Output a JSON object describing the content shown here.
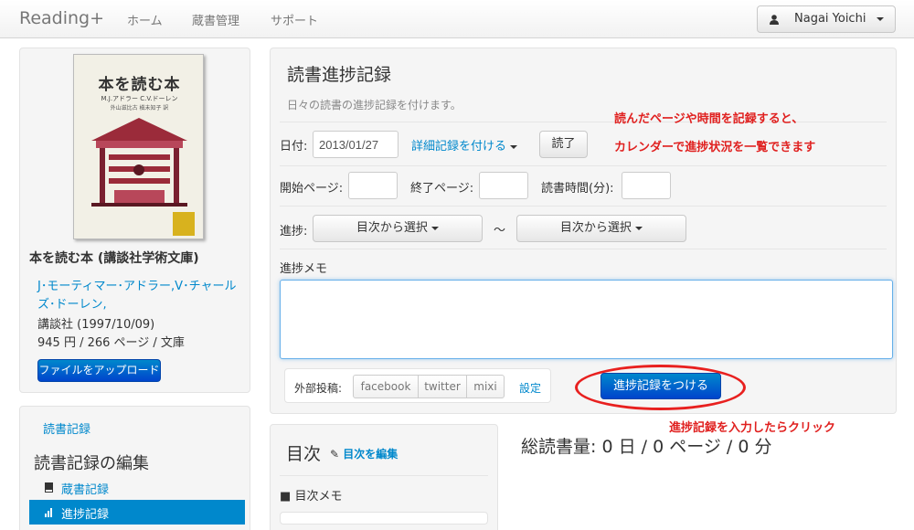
{
  "nav": {
    "brand": "Reading+",
    "home": "ホーム",
    "library": "蔵書管理",
    "support": "サポート",
    "user_name": "Nagai Yoichi"
  },
  "book": {
    "cover_title": "本を読む本",
    "cover_author": "M.J.アドラー  C.V.ドーレン",
    "cover_translator": "外山滋比古  槇未知子 訳",
    "title": "本を読む本 (講談社学術文庫)",
    "authors": "J･モーティマー･アドラー,V･チャールズ･ドーレン,",
    "publisher": "講談社 (1997/10/09)",
    "price_pages": "945 円 / 266 ページ / 文庫",
    "upload_button": "ファイルをアップロード"
  },
  "sidebar": {
    "reading_record_link": "読書記録",
    "edit_heading": "読書記録の編集",
    "items": [
      {
        "label": "蔵書記録",
        "active": false
      },
      {
        "label": "進捗記録",
        "active": true
      }
    ]
  },
  "form": {
    "heading": "読書進捗記録",
    "subtitle": "日々の読書の進捗記録を付けます。",
    "date_label": "日付:",
    "date_value": "2013/01/27",
    "detail_link": "詳細記録を付ける",
    "finish_button": "読了",
    "start_page_label": "開始ページ:",
    "end_page_label": "終了ページ:",
    "reading_time_label": "読書時間(分):",
    "progress_label": "進捗:",
    "toc_select_label": "目次から選択",
    "tilde": "〜",
    "memo_label": "進捗メモ",
    "external_post_label": "外部投稿:",
    "social": [
      "facebook",
      "twitter",
      "mixi"
    ],
    "settings_link": "設定",
    "submit_button": "進捗記録をつける"
  },
  "annotations": {
    "line1": "読んだページや時間を記録すると、",
    "line2": "カレンダーで進捗状況を一覧できます",
    "click_note": "進捗記録を入力したらクリック"
  },
  "toc": {
    "heading": "目次",
    "edit_link": "目次を編集",
    "memo_item": "目次メモ"
  },
  "stats": {
    "prefix": "総読書量:",
    "days": "0",
    "days_unit": "日",
    "pages": "0",
    "pages_unit": "ページ",
    "minutes": "0",
    "minutes_unit": "分"
  },
  "colors": {
    "link": "#0088cc",
    "primary": "#0055cc",
    "annotation": "#e0201f",
    "active_sidebar": "#0088cc"
  }
}
